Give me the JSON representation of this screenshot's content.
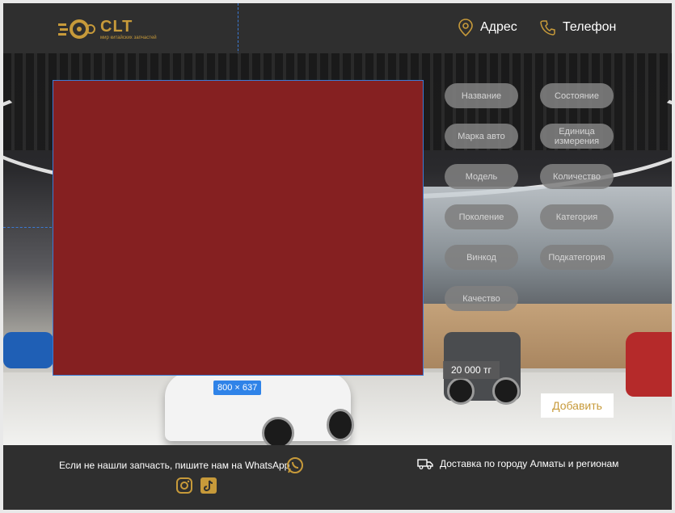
{
  "header": {
    "brand": "CLT",
    "tagline": "мир китайских запчастей",
    "address_label": "Адрес",
    "phone_label": "Телефон"
  },
  "editor": {
    "placeholder_size": "800 × 637"
  },
  "filters": {
    "left": [
      "Название",
      "Марка авто",
      "Модель",
      "Поколение",
      "Винкод",
      "Качество"
    ],
    "right": [
      "Состояние",
      "Единица измерения",
      "Количество",
      "Категория",
      "Подкатегория"
    ]
  },
  "product": {
    "price": "20 000 тг",
    "add_label": "Добавить"
  },
  "footer": {
    "whatsapp_text": "Если не нашли запчасть, пишите нам на WhatsApp",
    "delivery_text": "Доставка по городу Алматы и регионам"
  },
  "colors": {
    "accent": "#c79a3a",
    "background": "#2f2f2f",
    "placeholder": "#852021",
    "chip": "#808080"
  }
}
